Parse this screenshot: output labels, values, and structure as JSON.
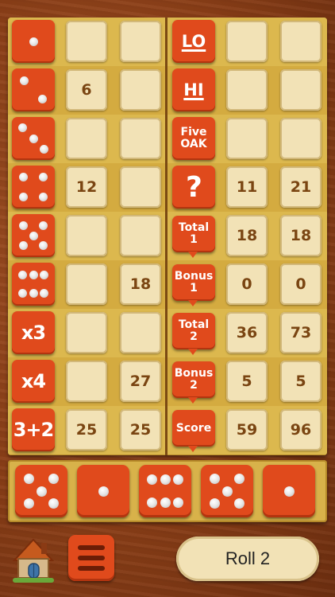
{
  "board": {
    "rows": [
      {
        "left": {
          "label": "",
          "pips": 1,
          "icon": "die-face-1-icon"
        },
        "c1": "",
        "c2": "",
        "right": {
          "label": "LO",
          "style": "lohi"
        },
        "c3": "",
        "c4": ""
      },
      {
        "left": {
          "label": "",
          "pips": 2,
          "icon": "die-face-2-icon"
        },
        "c1": "6",
        "c2": "",
        "right": {
          "label": "HI",
          "style": "lohi"
        },
        "c3": "",
        "c4": ""
      },
      {
        "left": {
          "label": "",
          "pips": 3,
          "icon": "die-face-3-icon"
        },
        "c1": "",
        "c2": "",
        "right": {
          "label": "Five\nOAK",
          "style": "tile"
        },
        "c3": "",
        "c4": ""
      },
      {
        "left": {
          "label": "",
          "pips": 4,
          "icon": "die-face-4-icon"
        },
        "c1": "12",
        "c2": "",
        "right": {
          "label": "?",
          "style": "question"
        },
        "c3": "11",
        "c4": "21"
      },
      {
        "left": {
          "label": "",
          "pips": 5,
          "icon": "die-face-5-icon"
        },
        "c1": "",
        "c2": "",
        "right": {
          "label": "Total\n1",
          "style": "bubble"
        },
        "c3": "18",
        "c4": "18"
      },
      {
        "left": {
          "label": "",
          "pips": 6,
          "icon": "die-face-6-icon"
        },
        "c1": "",
        "c2": "18",
        "right": {
          "label": "Bonus\n1",
          "style": "bubble"
        },
        "c3": "0",
        "c4": "0"
      },
      {
        "left": {
          "label": "x3",
          "pips": 0
        },
        "c1": "",
        "c2": "",
        "right": {
          "label": "Total\n2",
          "style": "bubble"
        },
        "c3": "36",
        "c4": "73"
      },
      {
        "left": {
          "label": "x4",
          "pips": 0
        },
        "c1": "",
        "c2": "27",
        "right": {
          "label": "Bonus\n2",
          "style": "bubble"
        },
        "c3": "5",
        "c4": "5"
      },
      {
        "left": {
          "label": "3+2",
          "pips": 0
        },
        "c1": "25",
        "c2": "25",
        "right": {
          "label": "Score",
          "style": "bubble"
        },
        "c3": "59",
        "c4": "96"
      }
    ]
  },
  "dice": [
    {
      "value": 5,
      "icon": "die-face-5-icon"
    },
    {
      "value": 1,
      "icon": "die-face-1-icon"
    },
    {
      "value": 6,
      "icon": "die-face-6-icon"
    },
    {
      "value": 5,
      "icon": "die-face-5-icon"
    },
    {
      "value": 1,
      "icon": "die-face-1-icon"
    }
  ],
  "controls": {
    "roll_label": "Roll 2",
    "home_icon": "house-icon",
    "menu_icon": "hamburger-menu-icon"
  },
  "colors": {
    "accent": "#e04a1c",
    "cell": "#f2e2b6",
    "board": "#d8b24a",
    "text": "#7a4512"
  }
}
